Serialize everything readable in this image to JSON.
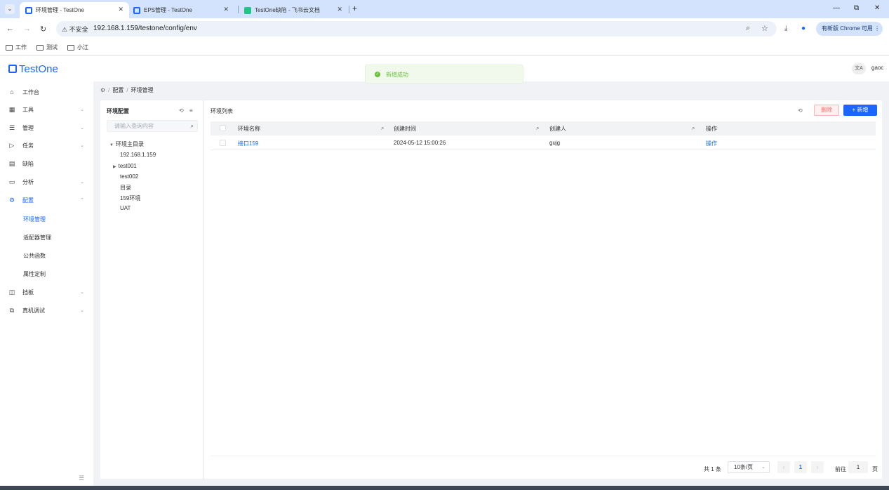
{
  "browser": {
    "tabs": [
      {
        "title": "环境管理 - TestOne",
        "active": true
      },
      {
        "title": "EPS管理 - TestOne",
        "active": false
      },
      {
        "title": "TestOne缺陷 - 飞书云文档",
        "active": false
      }
    ],
    "url_warning": "不安全",
    "url": "192.168.1.159/testone/config/env",
    "update_label": "有新版 Chrome 可用",
    "bookmarks": [
      "工作",
      "测试",
      "小江"
    ]
  },
  "app": {
    "logo": "TestOne",
    "toast": "新增成功",
    "lang_icon": "文A",
    "user": "gaoc"
  },
  "sidebar": {
    "items": [
      {
        "label": "工作台",
        "icon": "home-icon",
        "glyph": "⌂",
        "chev": ""
      },
      {
        "label": "工具",
        "icon": "grid-icon",
        "glyph": "▦",
        "chev": "⌄"
      },
      {
        "label": "管理",
        "icon": "list-icon",
        "glyph": "☰",
        "chev": "⌄"
      },
      {
        "label": "任务",
        "icon": "send-icon",
        "glyph": "▷",
        "chev": "⌄"
      },
      {
        "label": "缺陷",
        "icon": "doc-icon",
        "glyph": "▤",
        "chev": ""
      },
      {
        "label": "分析",
        "icon": "chart-icon",
        "glyph": "▭",
        "chev": "⌄"
      },
      {
        "label": "配置",
        "icon": "gear-icon",
        "glyph": "⚙",
        "chev": "⌃"
      }
    ],
    "sub_items": [
      "环境管理",
      "适配器管理",
      "公共函数",
      "属性定制"
    ],
    "items2": [
      {
        "label": "挡板",
        "icon": "panel-icon",
        "glyph": "◫",
        "chev": "⌄"
      },
      {
        "label": "真机调试",
        "icon": "device-icon",
        "glyph": "⧉",
        "chev": "⌄"
      }
    ]
  },
  "breadcrumb": {
    "level1": "配置",
    "level2": "环境管理"
  },
  "tree": {
    "title": "环境配置",
    "search_placeholder": "请输入查询内容",
    "root": "环境主目录",
    "nodes": [
      "192.168.1.159",
      "test001",
      "test002",
      "目录",
      "159环境",
      "UAT"
    ]
  },
  "table": {
    "title": "环境列表",
    "delete_label": "删除",
    "add_label": "+ 新增",
    "columns": [
      "环境名称",
      "创建时间",
      "创建人",
      "操作"
    ],
    "rows": [
      {
        "name": "接口159",
        "created": "2024-05-12 15:00:26",
        "creator": "gujg",
        "action": "操作"
      }
    ]
  },
  "pagination": {
    "total": "共 1 条",
    "page_size": "10条/页",
    "current": "1",
    "jump_prefix": "前往",
    "jump_value": "1",
    "jump_suffix": "页"
  }
}
